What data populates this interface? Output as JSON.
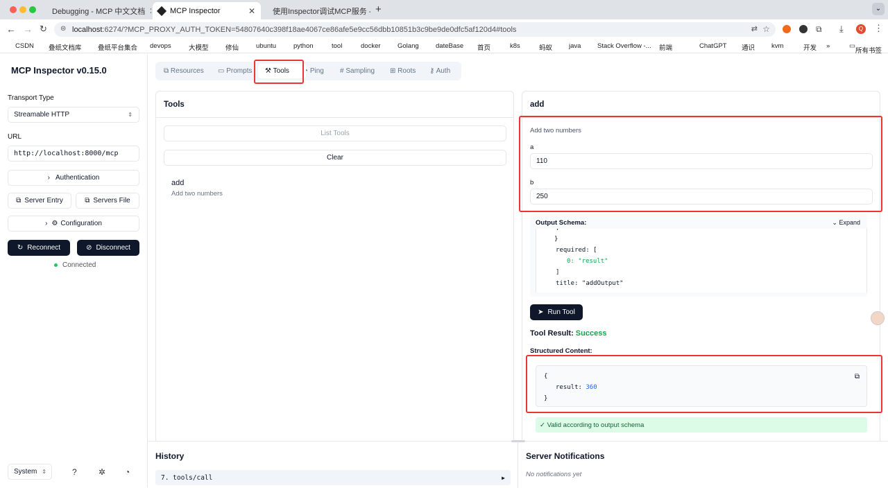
{
  "browser": {
    "tabs": [
      {
        "title": "Debugging - MCP 中文文档"
      },
      {
        "title": "MCP Inspector"
      },
      {
        "title": "使用Inspector调试MCP服务 - "
      }
    ],
    "url_host": "localhost",
    "url_rest": ":6274/?MCP_PROXY_AUTH_TOKEN=54807640c398f18ae4067ce86afe5e9cc56dbb10851b3c9be9de0dfc5af120d4#tools",
    "bookmarks": [
      "CSDN",
      "叠纸文档库",
      "叠纸平台集合",
      "devops",
      "大模型",
      "修仙",
      "ubuntu",
      "python",
      "tool",
      "docker",
      "Golang",
      "dateBase",
      "首页",
      "k8s",
      "蚂蚁",
      "java",
      "Stack Overflow -...",
      "前端",
      "ChatGPT",
      "通识",
      "kvm",
      "开发"
    ],
    "bookmarks_more": "»",
    "bookmarks_all": "所有书签",
    "profile_initial": "Q"
  },
  "sidebar": {
    "title": "MCP Inspector v0.15.0",
    "transport_label": "Transport Type",
    "transport_value": "Streamable HTTP",
    "url_label": "URL",
    "url_value": "http://localhost:8000/mcp",
    "auth": "Authentication",
    "server_entry": "Server Entry",
    "servers_file": "Servers File",
    "configuration": "Configuration",
    "reconnect": "Reconnect",
    "disconnect": "Disconnect",
    "status": "Connected",
    "theme": "System"
  },
  "tabs": [
    "Resources",
    "Prompts",
    "Tools",
    "Ping",
    "Sampling",
    "Roots",
    "Auth"
  ],
  "tools_panel": {
    "header": "Tools",
    "list": "List Tools",
    "clear": "Clear",
    "tool_name": "add",
    "tool_desc": "Add two numbers"
  },
  "detail": {
    "header": "add",
    "desc": "Add two numbers",
    "a_label": "a",
    "a_value": "110",
    "b_label": "b",
    "b_value": "250",
    "output_schema_label": "Output Schema:",
    "expand": "Expand",
    "schema_lines": [
      ",",
      "}",
      "required: [",
      "0: \"result\"",
      "]",
      "title: \"addOutput\""
    ],
    "run": "Run Tool",
    "result_label": "Tool Result:",
    "result_status": "Success",
    "structured_label": "Structured Content:",
    "json_open": "{",
    "json_key": "result:",
    "json_value": "360",
    "json_close": "}",
    "valid": "✓ Valid according to output schema"
  },
  "history": {
    "header": "History",
    "item": "7. tools/call"
  },
  "notifications": {
    "header": "Server Notifications",
    "empty": "No notifications yet"
  }
}
